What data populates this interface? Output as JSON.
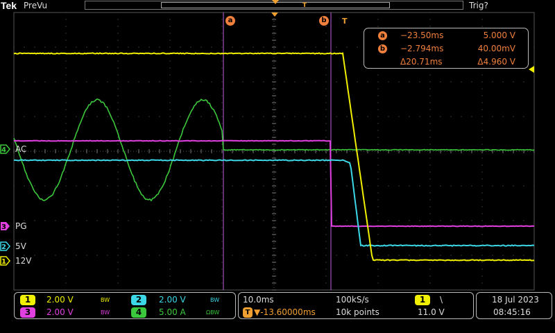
{
  "header": {
    "brand": "Tek",
    "mode": "PreVu",
    "trigger_state": "Trig?",
    "trigger_marker": "T"
  },
  "cursors": {
    "a_label": "a",
    "b_label": "b",
    "trigger_label": "T"
  },
  "readout": {
    "a": {
      "label": "a",
      "time": "−23.50ms",
      "volt": "5.000 V"
    },
    "b": {
      "label": "b",
      "time": "−2.794ms",
      "volt": "40.00mV"
    },
    "delta": {
      "time": "Δ20.71ms",
      "volt": "Δ4.960 V"
    }
  },
  "channels": [
    {
      "num": "4",
      "name": "AC",
      "color": "#3cc83c"
    },
    {
      "num": "3",
      "name": "PG",
      "color": "#e040e0"
    },
    {
      "num": "2",
      "name": "5V",
      "color": "#3cd8e8"
    },
    {
      "num": "1",
      "name": "12V",
      "color": "#f0f000"
    }
  ],
  "vertical": {
    "ch1": {
      "num": "1",
      "scale": "2.00 V",
      "bw": "BW",
      "color": "#f0f000"
    },
    "ch2": {
      "num": "2",
      "scale": "2.00 V",
      "bw": "BW",
      "color": "#3cd8e8"
    },
    "ch3": {
      "num": "3",
      "scale": "2.00 V",
      "bw": "BW",
      "color": "#e040e0"
    },
    "ch4": {
      "num": "4",
      "scale": "5.00 A",
      "bw": "ΩBW",
      "color": "#3cc83c"
    }
  },
  "horizontal": {
    "timebase": "10.0ms",
    "sample_rate": "100kS/s",
    "trigger_position": "▼-13.60000ms",
    "record_length": "10k points",
    "trigger_source": "1",
    "trigger_slope": "\\",
    "trigger_level": "11.0 V"
  },
  "datetime": {
    "date": "18 Jul  2023",
    "time": "08:45:16"
  }
}
